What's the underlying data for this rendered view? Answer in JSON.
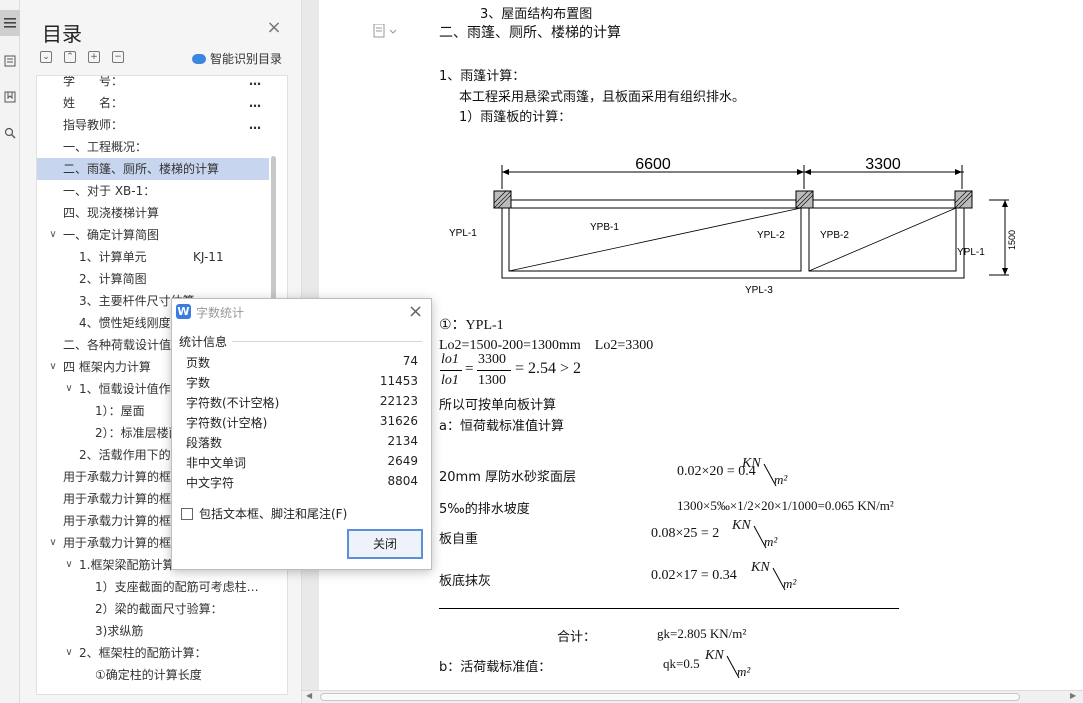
{
  "toc": {
    "title": "目录",
    "smart_label": "智能识别目录",
    "items": [
      {
        "label": "学　　号：",
        "extra": "",
        "dots": "…"
      },
      {
        "label": "姓　　名：",
        "extra": "",
        "dots": "…"
      },
      {
        "label": "指导教师：",
        "extra": "",
        "dots": "…"
      },
      {
        "label": "一、工程概况：",
        "extra": "",
        "dots": ""
      },
      {
        "label": "二、雨篷、厕所、楼梯的计算",
        "extra": "",
        "dots": ""
      },
      {
        "label": "一、对于 XB-1：",
        "extra": "",
        "dots": ""
      },
      {
        "label": "四、现浇楼梯计算",
        "extra": "",
        "dots": ""
      },
      {
        "label": "一、确定计算简图",
        "extra": "",
        "dots": ""
      },
      {
        "label": "1、计算单元",
        "extra": "KJ-11",
        "dots": ""
      },
      {
        "label": "2、计算简图",
        "extra": "",
        "dots": ""
      },
      {
        "label": "3、主要杆件尺寸估算",
        "extra": "",
        "dots": ""
      },
      {
        "label": "4、惯性矩线刚度",
        "extra": "",
        "dots": ""
      },
      {
        "label": "二、各种荷载设计值",
        "extra": "",
        "dots": ""
      },
      {
        "label": "四 框架内力计算",
        "extra": "",
        "dots": ""
      },
      {
        "label": "1、恒载设计值作用",
        "extra": "",
        "dots": ""
      },
      {
        "label": "1）：屋面",
        "extra": "",
        "dots": ""
      },
      {
        "label": "2）：标准层楼面",
        "extra": "",
        "dots": ""
      },
      {
        "label": "2、活载作用下的",
        "extra": "",
        "dots": ""
      },
      {
        "label": "用于承载力计算的框",
        "extra": "",
        "dots": ""
      },
      {
        "label": "用于承载力计算的框",
        "extra": "",
        "dots": ""
      },
      {
        "label": "用于承载力计算的框",
        "extra": "",
        "dots": ""
      },
      {
        "label": "用于承载力计算的框",
        "extra": "",
        "dots": ""
      },
      {
        "label": "1.框架梁配筋计算：",
        "extra": "",
        "dots": ""
      },
      {
        "label": "1）支座截面的配筋可考虑柱…",
        "extra": "",
        "dots": ""
      },
      {
        "label": "2）梁的截面尺寸验算：",
        "extra": "",
        "dots": ""
      },
      {
        "label": "3)求纵筋",
        "extra": "",
        "dots": ""
      },
      {
        "label": "2、框架柱的配筋计算：",
        "extra": "",
        "dots": ""
      },
      {
        "label": "①确定柱的计算长度",
        "extra": "",
        "dots": ""
      }
    ]
  },
  "dialog": {
    "title": "字数统计",
    "section": "统计信息",
    "stats": [
      {
        "label": "页数",
        "value": "74"
      },
      {
        "label": "字数",
        "value": "11453"
      },
      {
        "label": "字符数(不计空格)",
        "value": "22123"
      },
      {
        "label": "字符数(计空格)",
        "value": "31626"
      },
      {
        "label": "段落数",
        "value": "2134"
      },
      {
        "label": "非中文单词",
        "value": "2649"
      },
      {
        "label": "中文字符",
        "value": "8804"
      }
    ],
    "checkbox_label": "包括文本框、脚注和尾注(F)",
    "close_label": "关闭"
  },
  "document": {
    "top_line": "3、屋面结构布置图",
    "heading": "二、雨篷、厕所、楼梯的计算",
    "sub1": "1、雨篷计算：",
    "para1": "本工程采用悬梁式雨篷，且板面采用有组织排水。",
    "sub2": "1）雨篷板的计算：",
    "diagram": {
      "dim1": "6600",
      "dim2": "3300",
      "dim_v": "1500",
      "ypl1_left": "YPL-1",
      "ypb1": "YPB-1",
      "ypl2": "YPL-2",
      "ypb2": "YPB-2",
      "ypl1_right": "YPL-1",
      "ypl3": "YPL-3"
    },
    "ypl1": "①：YPL-1",
    "lo_line": "Lo2=1500-200=1300mm　Lo2=3300",
    "frac_num_l": "lo1",
    "frac_den_l": "lo1",
    "frac_num_r": "3300",
    "frac_den_r": "1300",
    "frac_tail": "= 2.54 > 2",
    "one_way": "所以可按单向板计算",
    "a_title": "a：恒荷载标准值计算",
    "row1_label": "20mm 厚防水砂浆面层",
    "row1_val": "0.02×20 = 0.4",
    "row2_label": "5‰的排水坡度",
    "row2_val": "1300×5‰×1/2×20×1/1000=0.065 KN/m²",
    "row3_label": "板自重",
    "row3_val": "0.08×25 = 2",
    "row4_label": "板底抹灰",
    "row4_val": "0.02×17 = 0.34",
    "unit_kn": "KN",
    "unit_m2": "m²",
    "total_label": "合计：",
    "total_val": "gk=2.805 KN/m²",
    "b_title": "b：活荷载标准值：",
    "b_val": "qk=0.5"
  }
}
